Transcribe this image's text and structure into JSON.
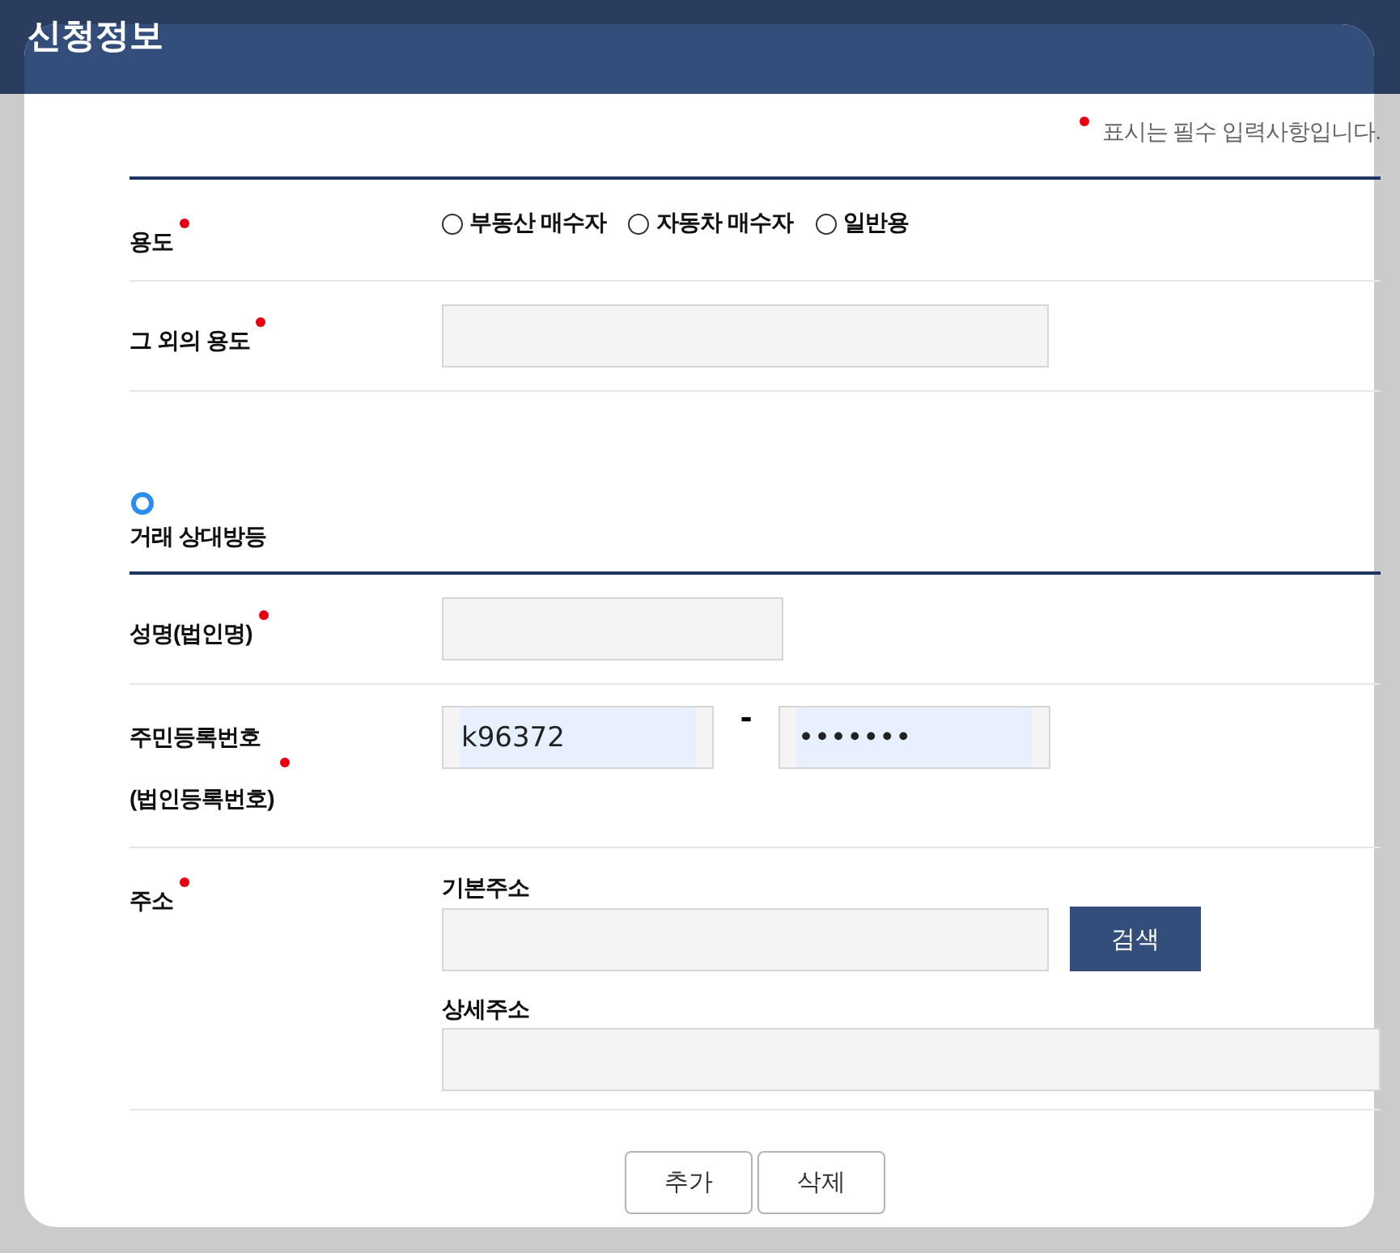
{
  "dialog": {
    "title": "신청정보"
  },
  "required_note": "표시는 필수 입력사항입니다.",
  "sections": [
    {
      "rows": [
        {
          "kind": "radio",
          "label_lines": [
            "용도"
          ],
          "required": true,
          "options": [
            {
              "label": "부동산 매수자",
              "selected": false
            },
            {
              "label": "자동차 매수자",
              "selected": false
            },
            {
              "label": "일반용",
              "selected": false
            }
          ]
        },
        {
          "kind": "text",
          "label_lines": [
            "그 외의 용도"
          ],
          "required": true
        }
      ]
    },
    {
      "heading": "거래 상대방등",
      "rows": [
        {
          "kind": "text",
          "label_lines": [
            "성명(법인명)"
          ],
          "required": true
        },
        {
          "kind": "split",
          "label_lines": [
            "주민등록번호",
            "(법인등록번호)"
          ],
          "required": true,
          "separator": "-",
          "fields": [
            {
              "value": "k96372",
              "autofilled": true
            },
            {
              "value": "•••••••",
              "autofilled": true
            }
          ]
        },
        {
          "kind": "address",
          "label_lines": [
            "주소"
          ],
          "required": true,
          "fields": [
            {
              "label": "기본주소",
              "button": "검색"
            },
            {
              "label": "상세주소"
            }
          ]
        }
      ]
    }
  ],
  "buttons": [
    "추가",
    "삭제"
  ]
}
